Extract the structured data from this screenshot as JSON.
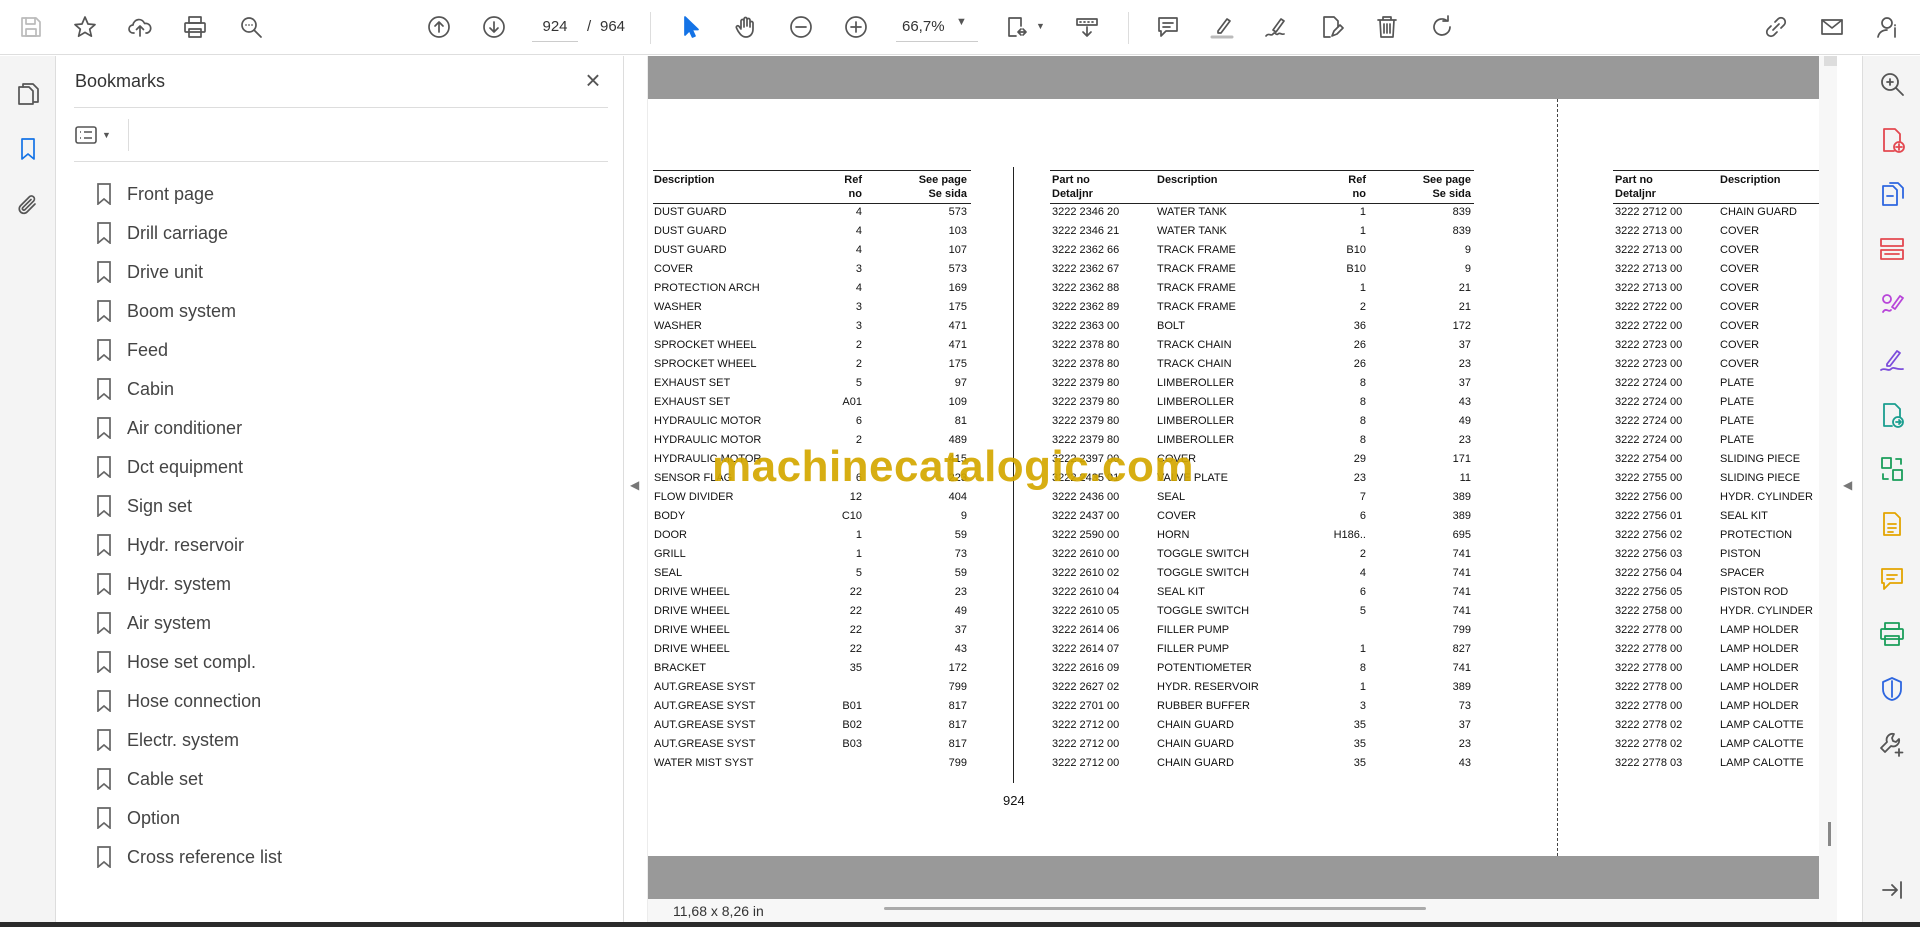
{
  "toolbar": {
    "page_current": "924",
    "page_separator": "/",
    "page_total": "964",
    "zoom": "66,7%"
  },
  "bookmarks_panel": {
    "title": "Bookmarks",
    "close_glyph": "×",
    "items": [
      "Front page",
      "Drill carriage",
      "Drive unit",
      "Boom system",
      "Feed",
      "Cabin",
      "Air conditioner",
      "Dct equipment",
      "Sign set",
      "Hydr. reservoir",
      "Hydr. system",
      "Air system",
      "Hose set compl.",
      "Hose connection",
      "Electr. system",
      "Cable set",
      "Option",
      "Cross reference list"
    ]
  },
  "document": {
    "page_number": "924",
    "watermark": "machinecatalogic.com",
    "col1_headers": {
      "desc": "Description",
      "ref1": "Ref",
      "ref2": "no",
      "see1": "See page",
      "see2": "Se sida"
    },
    "col2_headers": {
      "part1": "Part no",
      "part2": "Detaljnr",
      "desc": "Description",
      "ref1": "Ref",
      "ref2": "no",
      "see1": "See page",
      "see2": "Se sida"
    },
    "col3_headers": {
      "part1": "Part no",
      "part2": "Detaljnr",
      "desc": "Description"
    },
    "col1_rows": [
      [
        "DUST GUARD",
        "4",
        "573"
      ],
      [
        "DUST GUARD",
        "4",
        "103"
      ],
      [
        "DUST GUARD",
        "4",
        "107"
      ],
      [
        "COVER",
        "3",
        "573"
      ],
      [
        "PROTECTION ARCH",
        "4",
        "169"
      ],
      [
        "WASHER",
        "3",
        "175"
      ],
      [
        "WASHER",
        "3",
        "471"
      ],
      [
        "SPROCKET WHEEL",
        "2",
        "471"
      ],
      [
        "SPROCKET WHEEL",
        "2",
        "175"
      ],
      [
        "EXHAUST SET",
        "5",
        "97"
      ],
      [
        "EXHAUST SET",
        "A01",
        "109"
      ],
      [
        "HYDRAULIC MOTOR",
        "6",
        "81"
      ],
      [
        "HYDRAULIC MOTOR",
        "2",
        "489"
      ],
      [
        "HYDRAULIC MOTOR",
        "",
        "415"
      ],
      [
        "SENSOR FLAG",
        "6",
        "223"
      ],
      [
        "FLOW DIVIDER",
        "12",
        "404"
      ],
      [
        "BODY",
        "C10",
        "9"
      ],
      [
        "DOOR",
        "1",
        "59"
      ],
      [
        "GRILL",
        "1",
        "73"
      ],
      [
        "SEAL",
        "5",
        "59"
      ],
      [
        "DRIVE WHEEL",
        "22",
        "23"
      ],
      [
        "DRIVE WHEEL",
        "22",
        "49"
      ],
      [
        "DRIVE WHEEL",
        "22",
        "37"
      ],
      [
        "DRIVE WHEEL",
        "22",
        "43"
      ],
      [
        "BRACKET",
        "35",
        "172"
      ],
      [
        "AUT.GREASE SYST",
        "",
        "799"
      ],
      [
        "AUT.GREASE SYST",
        "B01",
        "817"
      ],
      [
        "AUT.GREASE SYST",
        "B02",
        "817"
      ],
      [
        "AUT.GREASE SYST",
        "B03",
        "817"
      ],
      [
        "WATER MIST SYST",
        "",
        "799"
      ]
    ],
    "col2_rows": [
      [
        "3222 2346 20",
        "WATER TANK",
        "1",
        "839"
      ],
      [
        "3222 2346 21",
        "WATER TANK",
        "1",
        "839"
      ],
      [
        "3222 2362 66",
        "TRACK FRAME",
        "B10",
        "9"
      ],
      [
        "3222 2362 67",
        "TRACK FRAME",
        "B10",
        "9"
      ],
      [
        "3222 2362 88",
        "TRACK FRAME",
        "1",
        "21"
      ],
      [
        "3222 2362 89",
        "TRACK FRAME",
        "2",
        "21"
      ],
      [
        "3222 2363 00",
        "BOLT",
        "36",
        "172"
      ],
      [
        "3222 2378 80",
        "TRACK CHAIN",
        "26",
        "37"
      ],
      [
        "3222 2378 80",
        "TRACK CHAIN",
        "26",
        "23"
      ],
      [
        "3222 2379 80",
        "LIMBEROLLER",
        "8",
        "37"
      ],
      [
        "3222 2379 80",
        "LIMBEROLLER",
        "8",
        "43"
      ],
      [
        "3222 2379 80",
        "LIMBEROLLER",
        "8",
        "49"
      ],
      [
        "3222 2379 80",
        "LIMBEROLLER",
        "8",
        "23"
      ],
      [
        "3222 2397 00",
        "COVER",
        "29",
        "171"
      ],
      [
        "3222 2435 01",
        "VALVE PLATE",
        "23",
        "11"
      ],
      [
        "3222 2436 00",
        "SEAL",
        "7",
        "389"
      ],
      [
        "3222 2437 00",
        "COVER",
        "6",
        "389"
      ],
      [
        "3222 2590 00",
        "HORN",
        "H186..",
        "695"
      ],
      [
        "3222 2610 00",
        "TOGGLE SWITCH",
        "2",
        "741"
      ],
      [
        "3222 2610 02",
        "TOGGLE SWITCH",
        "4",
        "741"
      ],
      [
        "3222 2610 04",
        "SEAL KIT",
        "6",
        "741"
      ],
      [
        "3222 2610 05",
        "TOGGLE SWITCH",
        "5",
        "741"
      ],
      [
        "3222 2614 06",
        "FILLER PUMP",
        "",
        "799"
      ],
      [
        "3222 2614 07",
        "FILLER PUMP",
        "1",
        "827"
      ],
      [
        "3222 2616 09",
        "POTENTIOMETER",
        "8",
        "741"
      ],
      [
        "3222 2627 02",
        "HYDR. RESERVOIR",
        "1",
        "389"
      ],
      [
        "3222 2701 00",
        "RUBBER BUFFER",
        "3",
        "73"
      ],
      [
        "3222 2712 00",
        "CHAIN GUARD",
        "35",
        "37"
      ],
      [
        "3222 2712 00",
        "CHAIN GUARD",
        "35",
        "23"
      ],
      [
        "3222 2712 00",
        "CHAIN GUARD",
        "35",
        "43"
      ]
    ],
    "col3_rows": [
      [
        "3222 2712 00",
        "CHAIN GUARD"
      ],
      [
        "3222 2713 00",
        "COVER"
      ],
      [
        "3222 2713 00",
        "COVER"
      ],
      [
        "3222 2713 00",
        "COVER"
      ],
      [
        "3222 2713 00",
        "COVER"
      ],
      [
        "3222 2722 00",
        "COVER"
      ],
      [
        "3222 2722 00",
        "COVER"
      ],
      [
        "3222 2723 00",
        "COVER"
      ],
      [
        "3222 2723 00",
        "COVER"
      ],
      [
        "3222 2724 00",
        "PLATE"
      ],
      [
        "3222 2724 00",
        "PLATE"
      ],
      [
        "3222 2724 00",
        "PLATE"
      ],
      [
        "3222 2724 00",
        "PLATE"
      ],
      [
        "3222 2754 00",
        "SLIDING PIECE"
      ],
      [
        "3222 2755 00",
        "SLIDING PIECE"
      ],
      [
        "3222 2756 00",
        "HYDR. CYLINDER"
      ],
      [
        "3222 2756 01",
        "SEAL KIT"
      ],
      [
        "3222 2756 02",
        "PROTECTION"
      ],
      [
        "3222 2756 03",
        "PISTON"
      ],
      [
        "3222 2756 04",
        "SPACER"
      ],
      [
        "3222 2756 05",
        "PISTON ROD"
      ],
      [
        "3222 2758 00",
        "HYDR. CYLINDER"
      ],
      [
        "3222 2778 00",
        "LAMP HOLDER"
      ],
      [
        "3222 2778 00",
        "LAMP HOLDER"
      ],
      [
        "3222 2778 00",
        "LAMP HOLDER"
      ],
      [
        "3222 2778 00",
        "LAMP HOLDER"
      ],
      [
        "3222 2778 00",
        "LAMP HOLDER"
      ],
      [
        "3222 2778 02",
        "LAMP CALOTTE"
      ],
      [
        "3222 2778 02",
        "LAMP CALOTTE"
      ],
      [
        "3222 2778 03",
        "LAMP CALOTTE"
      ]
    ]
  },
  "status": {
    "page_size": "11,68 x 8,26 in"
  },
  "colors": {
    "accent": "#1473e6",
    "watermark": "#d4a800",
    "page_gutter": "#999999"
  },
  "icons": {
    "top_toolbar": [
      "save-icon",
      "star-icon",
      "upload-icon",
      "print-icon",
      "find-icon",
      "page-up-icon",
      "page-down-icon",
      "select-cursor-icon",
      "hand-icon",
      "zoom-out-icon",
      "zoom-in-icon",
      "fit-page-icon",
      "scroll-mode-icon",
      "comment-icon",
      "highlight-icon",
      "sign-icon",
      "edit-pdf-icon",
      "delete-icon",
      "rotate-icon",
      "share-link-icon",
      "mail-icon",
      "account-icon"
    ],
    "left_rail": [
      "pages-icon",
      "bookmark-icon",
      "attachment-icon"
    ],
    "right_rail": [
      "zoom-search-icon",
      "create-pdf-icon",
      "export-pdf-icon",
      "organize-pages-icon",
      "fill-sign-icon",
      "request-signature-icon",
      "combine-files-icon",
      "compress-icon",
      "edit-pdf-icon",
      "comment-icon",
      "print-production-icon",
      "protect-icon",
      "more-tools-icon",
      "collapse-panel-icon"
    ]
  }
}
